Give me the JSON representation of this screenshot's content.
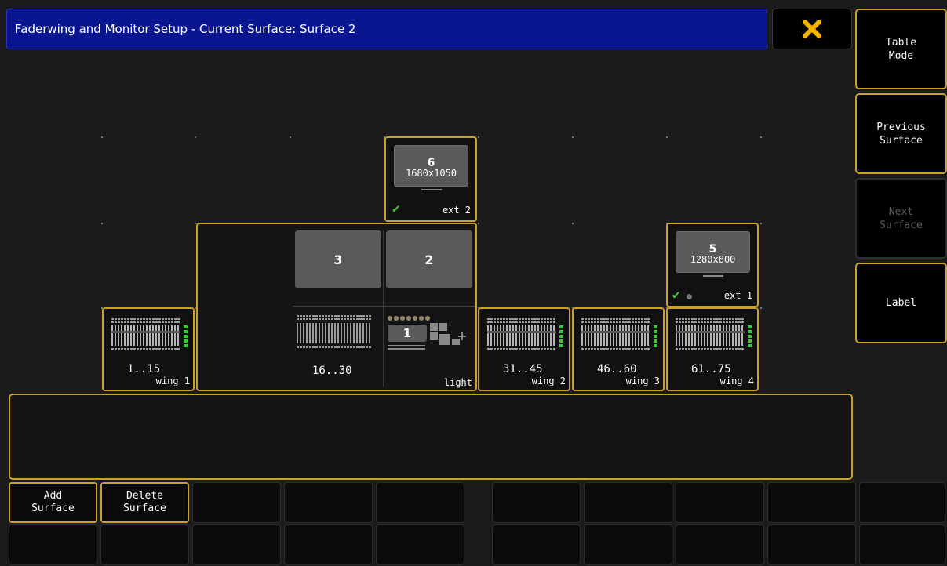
{
  "window": {
    "title": "Faderwing and Monitor Setup - Current Surface: Surface 2",
    "close_icon": "close-x-icon",
    "accent_color": "#c9a227",
    "title_color": "#0a1690"
  },
  "sidebar": {
    "buttons": [
      {
        "label": "Table\nMode",
        "enabled": true
      },
      {
        "label": "Previous\nSurface",
        "enabled": true
      },
      {
        "label": "Next\nSurface",
        "enabled": false
      },
      {
        "label": "Label",
        "enabled": true
      }
    ]
  },
  "surface": {
    "monitor_top": {
      "number": "6",
      "resolution": "1680x1050",
      "ext": "ext 2",
      "status_icon": "check-icon"
    },
    "monitor_right": {
      "number": "5",
      "resolution": "1280x800",
      "ext": "ext 1",
      "status_icon": "check-icon"
    },
    "console_screens": [
      "3",
      "2",
      "1"
    ],
    "console_range": "16..30",
    "console_name": "light",
    "wings": [
      {
        "range": "1..15",
        "name": "wing 1"
      },
      {
        "range": "31..45",
        "name": "wing 2"
      },
      {
        "range": "46..60",
        "name": "wing 3"
      },
      {
        "range": "61..75",
        "name": "wing 4"
      }
    ]
  },
  "bottom": {
    "add_surface": "Add\nSurface",
    "delete_surface": "Delete\nSurface"
  }
}
